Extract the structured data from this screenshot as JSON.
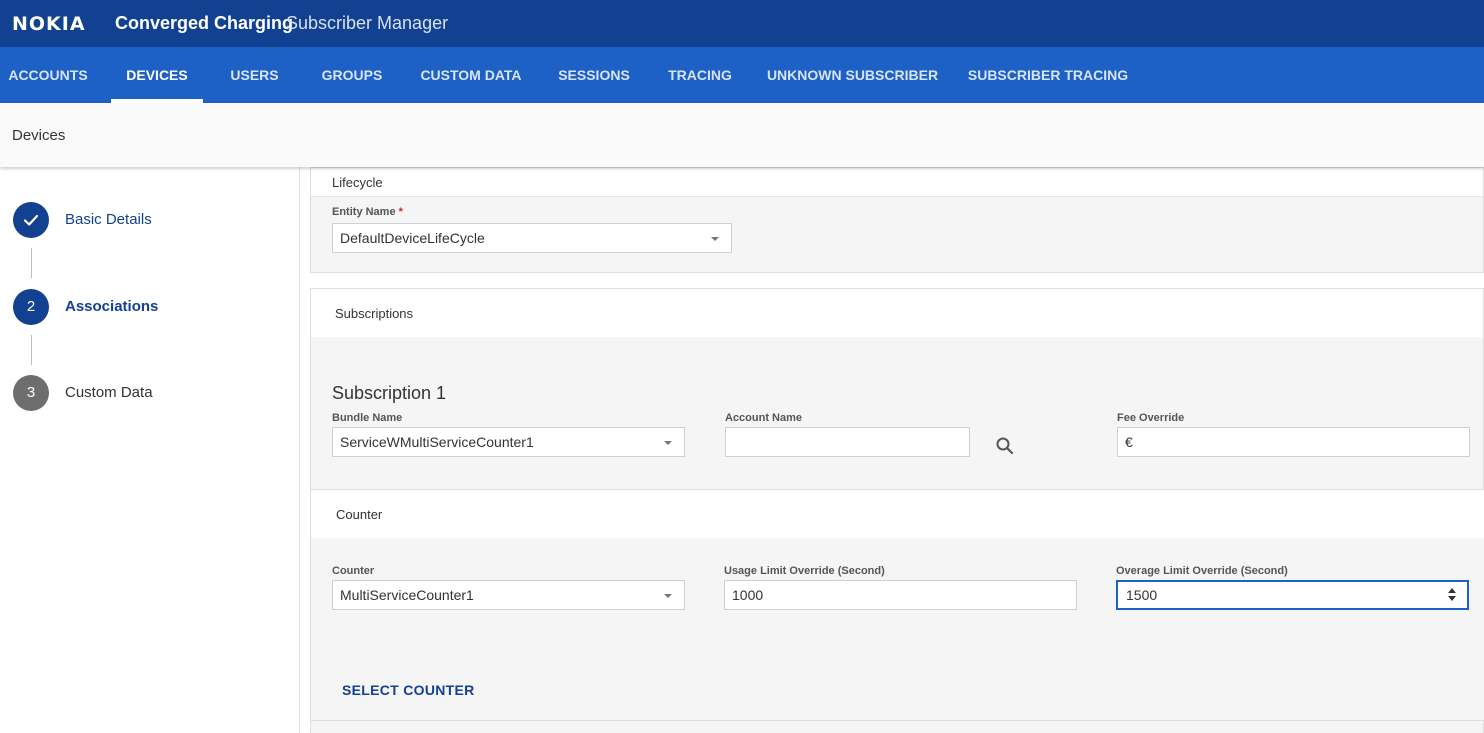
{
  "header": {
    "logo": "NOKIA",
    "product": "Converged Charging",
    "app": "Subscriber Manager"
  },
  "nav": {
    "tabs": [
      {
        "label": "ACCOUNTS"
      },
      {
        "label": "DEVICES"
      },
      {
        "label": "USERS"
      },
      {
        "label": "GROUPS"
      },
      {
        "label": "CUSTOM DATA"
      },
      {
        "label": "SESSIONS"
      },
      {
        "label": "TRACING"
      },
      {
        "label": "UNKNOWN SUBSCRIBER"
      },
      {
        "label": "SUBSCRIBER TRACING"
      }
    ],
    "active": "DEVICES"
  },
  "breadcrumb": "Devices",
  "steps": [
    {
      "number": "",
      "label": "Basic Details",
      "state": "done"
    },
    {
      "number": "2",
      "label": "Associations",
      "state": "current"
    },
    {
      "number": "3",
      "label": "Custom Data",
      "state": "todo"
    }
  ],
  "lifecycle": {
    "title": "Lifecycle",
    "entity_label": "Entity Name",
    "required_mark": "*",
    "entity_value": "DefaultDeviceLifeCycle"
  },
  "subscriptions": {
    "title": "Subscriptions",
    "subscription_title": "Subscription 1",
    "bundle_label": "Bundle Name",
    "bundle_value": "ServiceWMultiServiceCounter1",
    "account_label": "Account Name",
    "account_value": "",
    "fee_label": "Fee Override",
    "fee_value": "€"
  },
  "counter": {
    "title": "Counter",
    "counter_label": "Counter",
    "counter_value": "MultiServiceCounter1",
    "usage_label": "Usage Limit Override (Second)",
    "usage_value": "1000",
    "overage_label": "Overage Limit Override (Second)",
    "overage_value": "1500",
    "select_button": "SELECT COUNTER"
  },
  "colors": {
    "brand_dark": "#124191",
    "nav_blue": "#1d61c7"
  }
}
